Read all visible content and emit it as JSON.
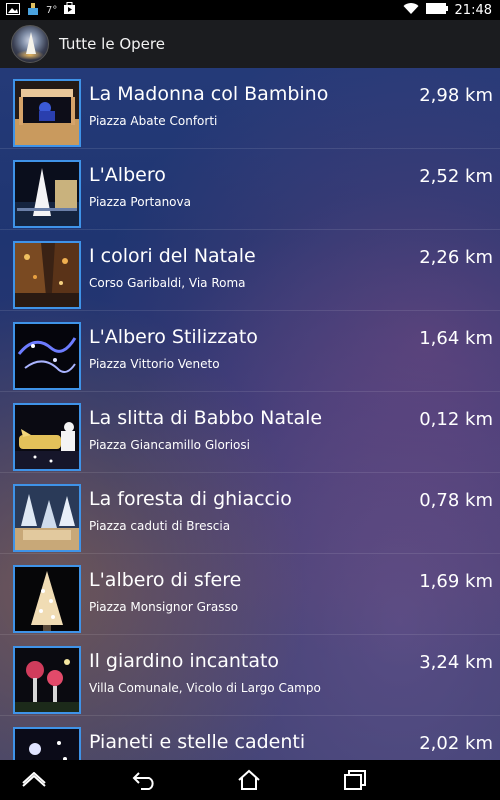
{
  "status_bar": {
    "temperature": "7°",
    "time": "21:48",
    "icons": [
      "image-icon",
      "cleaner-icon",
      "weather-icon",
      "bag-icon",
      "wifi-icon",
      "battery-icon"
    ]
  },
  "action_bar": {
    "title": "Tutte le Opere",
    "logo": "app-logo-icon"
  },
  "list": {
    "items": [
      {
        "title": "La Madonna col Bambino",
        "subtitle": "Piazza Abate Conforti",
        "distance": "2,98 km"
      },
      {
        "title": "L'Albero",
        "subtitle": "Piazza Portanova",
        "distance": "2,52 km"
      },
      {
        "title": "I colori del Natale",
        "subtitle": "Corso Garibaldi, Via Roma",
        "distance": "2,26 km"
      },
      {
        "title": "L'Albero Stilizzato",
        "subtitle": "Piazza Vittorio Veneto",
        "distance": "1,64 km"
      },
      {
        "title": "La slitta di Babbo Natale",
        "subtitle": "Piazza Giancamillo Gloriosi",
        "distance": "0,12 km"
      },
      {
        "title": "La foresta di ghiaccio",
        "subtitle": "Piazza caduti di Brescia",
        "distance": "0,78 km"
      },
      {
        "title": "L'albero di sfere",
        "subtitle": "Piazza Monsignor Grasso",
        "distance": "1,69 km"
      },
      {
        "title": "Il giardino incantato",
        "subtitle": "Villa Comunale, Vicolo di Largo Campo",
        "distance": "3,24 km"
      },
      {
        "title": "Pianeti e stelle cadenti",
        "subtitle": "",
        "distance": "2,02 km"
      }
    ]
  },
  "nav_bar": {
    "buttons": [
      "home-up-icon",
      "back-icon",
      "home-icon",
      "recent-apps-icon"
    ]
  },
  "colors": {
    "thumb_border": "#3f93e8",
    "action_bar": "#1b1c1f",
    "list_background": "#243a78"
  }
}
